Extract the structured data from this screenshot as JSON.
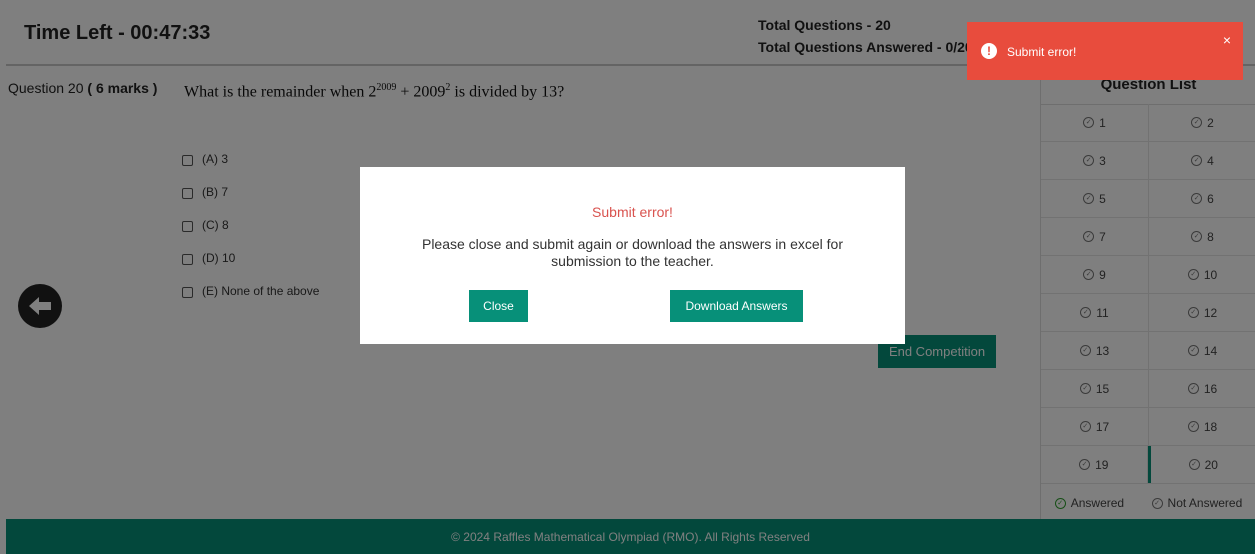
{
  "header": {
    "timer": "Time Left - 00:47:33",
    "total_questions": "Total Questions - 20",
    "total_answered": "Total Questions Answered - 0/20"
  },
  "question": {
    "number_label": "Question 20",
    "marks": "( 6 marks )",
    "text_prefix": "What is the remainder when 2",
    "exp1": "2009",
    "text_middle": " + 2009",
    "exp2": "2",
    "text_suffix": " is divided by 13?",
    "options": [
      "(A) 3",
      "(B) 7",
      "(C) 8",
      "(D) 10",
      "(E) None of the above"
    ]
  },
  "buttons": {
    "end_competition": "End Competition"
  },
  "question_list": {
    "title": "Question List",
    "items": [
      "1",
      "2",
      "3",
      "4",
      "5",
      "6",
      "7",
      "8",
      "9",
      "10",
      "11",
      "12",
      "13",
      "14",
      "15",
      "16",
      "17",
      "18",
      "19",
      "20"
    ],
    "current": "20",
    "legend_answered": "Answered",
    "legend_not_answered": "Not Answered"
  },
  "footer": {
    "text": "© 2024 Raffles Mathematical Olympiad (RMO). All Rights Reserved"
  },
  "modal": {
    "title": "Submit error!",
    "body": "Please close and submit again or download the answers in excel for submission to the teacher.",
    "close_label": "Close",
    "download_label": "Download Answers"
  },
  "toast": {
    "message": "Submit error!",
    "close": "×",
    "icon": "!"
  },
  "colors": {
    "accent": "#079079",
    "error": "#e84c3d",
    "error_text": "#d9534f"
  }
}
